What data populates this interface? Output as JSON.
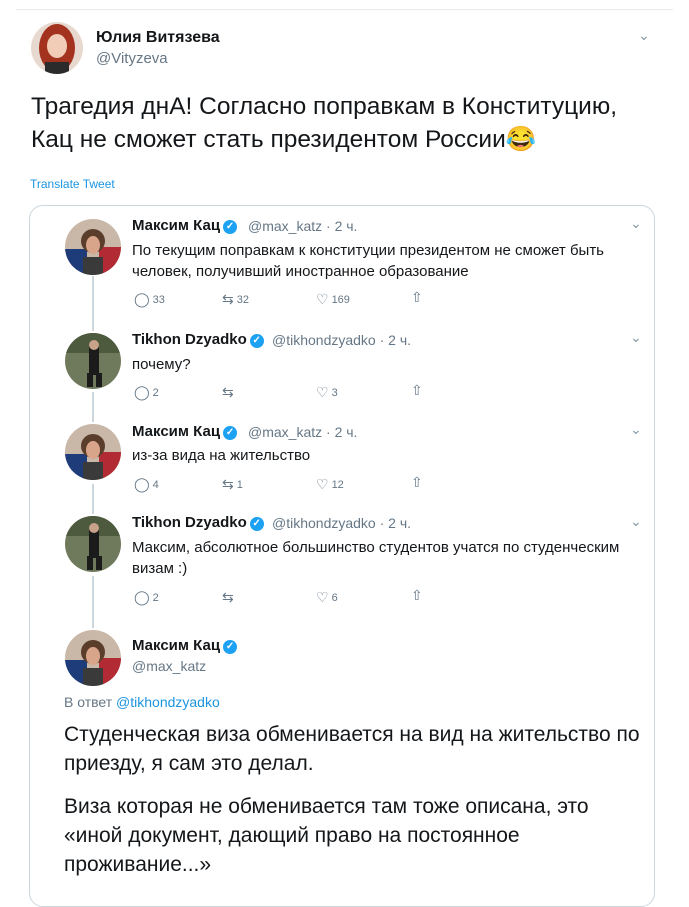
{
  "author": {
    "name": "Юлия Витязева",
    "handle": "@Vityzeva"
  },
  "main_tweet": {
    "text": "Трагедия днА! Согласно поправкам в Конституцию, Кац не сможет стать президентом России😂",
    "translate_label": "Translate Tweet"
  },
  "thread": [
    {
      "name": "Максим Кац",
      "handle": "@max_katz",
      "time": "· 2 ч.",
      "text": "По текущим поправкам к конституции президентом не сможет быть человек, получивший иностранное образование",
      "replies": "33",
      "retweets": "32",
      "likes": "169"
    },
    {
      "name": "Tikhon Dzyadko",
      "handle": "@tikhondzyadko",
      "time": "· 2 ч.",
      "text": "почему?",
      "replies": "2",
      "retweets": "",
      "likes": "3"
    },
    {
      "name": "Максим Кац",
      "handle": "@max_katz",
      "time": "· 2 ч.",
      "text": "из-за вида на жительство",
      "replies": "4",
      "retweets": "1",
      "likes": "12"
    },
    {
      "name": "Tikhon Dzyadko",
      "handle": "@tikhondzyadko",
      "time": "· 2 ч.",
      "text": "Максим, абсолютное большинство студентов учатся по студенческим визам :)",
      "replies": "2",
      "retweets": "",
      "likes": "6"
    }
  ],
  "final_tweet": {
    "name": "Максим Кац",
    "handle": "@max_katz",
    "reply_prefix": "В ответ",
    "reply_handle": "@tikhondzyadko",
    "paragraph1": "Студенческая виза обменивается на вид на жительство по приезду, я сам это делал.",
    "paragraph2": "Виза которая не обменивается там тоже описана, это «иной документ, дающий право на постоянное проживание...»"
  },
  "icons": {
    "verified": "verified-badge",
    "reply": "reply-icon",
    "retweet": "retweet-icon",
    "like": "heart-icon",
    "share": "share-icon",
    "menu": "chevron-down-icon"
  },
  "colors": {
    "link": "#1b95e0",
    "verified": "#1da1f2",
    "muted": "#657786",
    "border": "#ccd6dd"
  }
}
